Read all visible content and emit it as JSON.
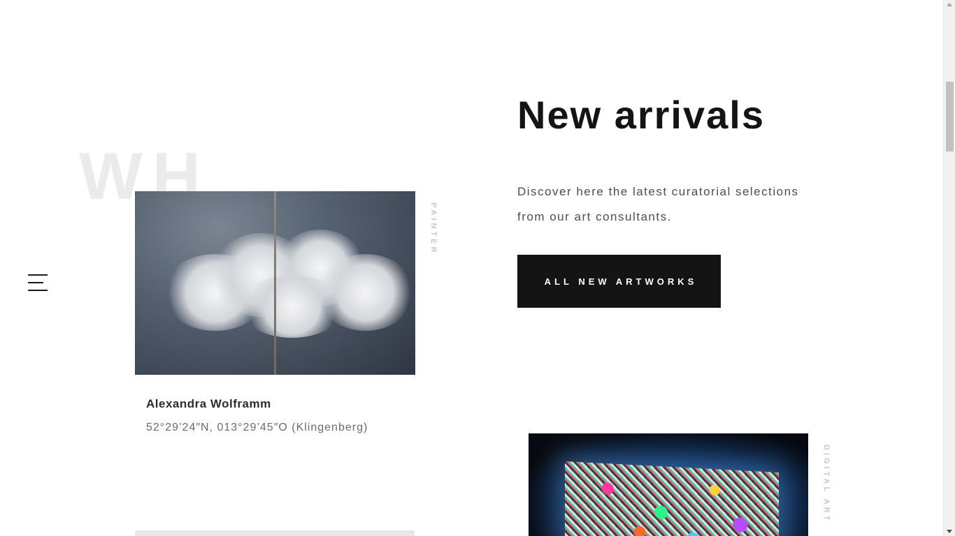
{
  "watermark": {
    "text": "WH"
  },
  "menu": {
    "icon": "hamburger-menu-icon"
  },
  "section": {
    "title": "New arrivals",
    "intro": "Discover here the latest curatorial selections from our art consultants.",
    "cta_label": "ALL NEW ARTWORKS"
  },
  "artworks": [
    {
      "category": "PAINTER",
      "artist": "Alexandra Wolframm",
      "location": "52°29’24″N, 013°29’45″O (Klingenberg)",
      "image": "cloud-diptych-painting"
    },
    {
      "category": "DIGITAL ART",
      "image": "illuminated-collage-installation"
    }
  ],
  "colors": {
    "text": "#141414",
    "muted": "#6b6b6b",
    "watermark": "#ebebeb",
    "button_bg": "#141414",
    "button_text": "#ffffff",
    "vertical_label": "#c8c8c8"
  }
}
